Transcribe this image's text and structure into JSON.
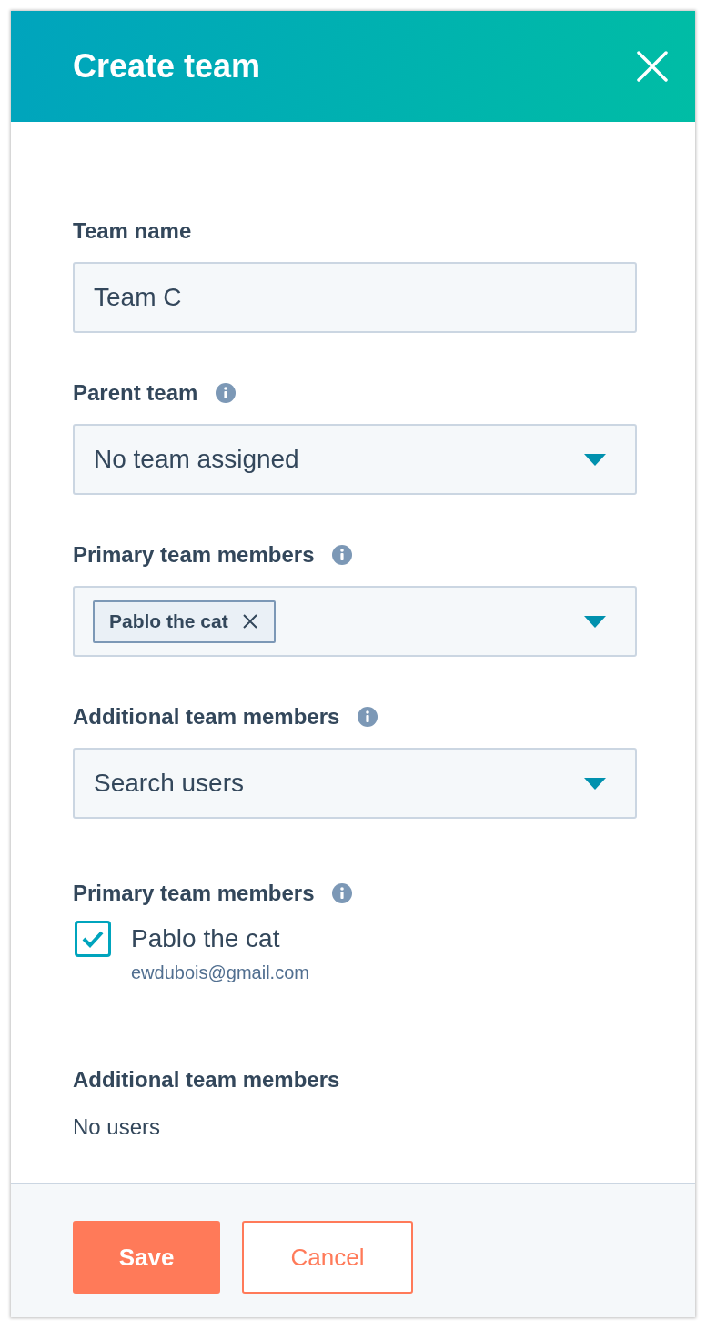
{
  "header": {
    "title": "Create team"
  },
  "fields": [
    {
      "kind": "text",
      "label": "Team name",
      "info": false,
      "value": "Team C"
    },
    {
      "kind": "select",
      "label": "Parent team",
      "info": true,
      "value": "No team assigned"
    },
    {
      "kind": "tags",
      "label": "Primary team members",
      "info": true,
      "tags": [
        "Pablo the cat"
      ]
    },
    {
      "kind": "select",
      "label": "Additional team members",
      "info": true,
      "placeholder": "Search users"
    }
  ],
  "primary_section": {
    "title": "Primary team members",
    "info": true,
    "members": [
      {
        "name": "Pablo the cat",
        "email": "ewdubois@gmail.com",
        "checked": true
      }
    ]
  },
  "additional_section": {
    "title": "Additional team members",
    "empty_text": "No users"
  },
  "buttons": [
    {
      "label": "Save",
      "kind": "primary"
    },
    {
      "label": "Cancel",
      "kind": "secondary"
    }
  ]
}
